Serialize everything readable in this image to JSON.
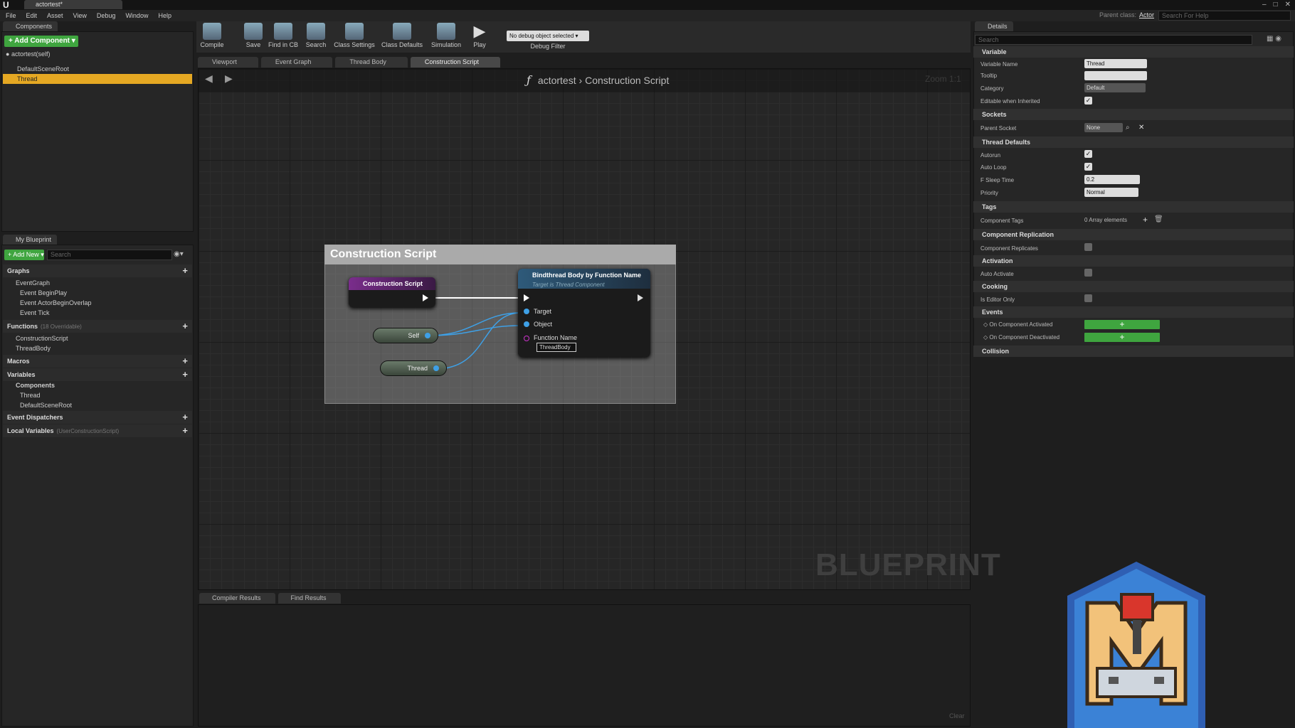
{
  "window": {
    "logo": "U",
    "doc_tab": "actortest*"
  },
  "menu": [
    "File",
    "Edit",
    "Asset",
    "View",
    "Debug",
    "Window",
    "Help"
  ],
  "parent_class": {
    "label": "Parent class:",
    "value": "Actor"
  },
  "help_search": {
    "placeholder": "Search For Help"
  },
  "components_panel": {
    "tab": "Components",
    "add_button": "+ Add Component ▾",
    "self_label": "actortest(self)",
    "items": [
      "DefaultSceneRoot",
      "Thread"
    ],
    "selected": "Thread"
  },
  "toolbar": {
    "buttons": [
      "Compile",
      "Save",
      "Find in CB",
      "Search",
      "Class Settings",
      "Class Defaults",
      "Simulation",
      "Play"
    ],
    "debug_select": "No debug object selected ▾",
    "debug_label": "Debug Filter"
  },
  "graph_tabs": [
    "Viewport",
    "Event Graph",
    "Thread Body",
    "Construction Script"
  ],
  "graph": {
    "breadcrumb_root": "actortest",
    "breadcrumb_sep": "›",
    "breadcrumb_current": "Construction Script",
    "zoom": "Zoom 1:1",
    "watermark": "BLUEPRINT",
    "comment_title": "Construction Script",
    "nodes": {
      "construction": "Construction Script",
      "self": "Self",
      "thread": "Thread",
      "bind_title": "Bindthread Body by Function Name",
      "bind_subtitle": "Target is Thread Component",
      "pin_target": "Target",
      "pin_object": "Object",
      "pin_function": "Function Name",
      "function_value": "ThreadBody"
    }
  },
  "my_blueprint": {
    "tab": "My Blueprint",
    "add_new": "+ Add New ▾",
    "search_placeholder": "Search",
    "graphs": "Graphs",
    "event_graph": "EventGraph",
    "events": [
      "Event BeginPlay",
      "Event ActorBeginOverlap",
      "Event Tick"
    ],
    "functions": "Functions",
    "functions_sub": "(18 Overridable)",
    "function_items": [
      "ConstructionScript",
      "ThreadBody"
    ],
    "macros": "Macros",
    "variables": "Variables",
    "components": "Components",
    "component_items": [
      "Thread",
      "DefaultSceneRoot"
    ],
    "dispatchers": "Event Dispatchers",
    "local_vars": "Local Variables",
    "local_vars_sub": "(UserConstructionScript)"
  },
  "bottom_tabs": [
    "Compiler Results",
    "Find Results"
  ],
  "clear": "Clear",
  "details": {
    "tab": "Details",
    "search_placeholder": "Search",
    "sections": {
      "variable": "Variable",
      "sockets": "Sockets",
      "thread_defaults": "Thread Defaults",
      "tags": "Tags",
      "replication": "Component Replication",
      "activation": "Activation",
      "cooking": "Cooking",
      "events": "Events",
      "collision": "Collision"
    },
    "labels": {
      "variable_name": "Variable Name",
      "tooltip": "Tooltip",
      "category": "Category",
      "editable": "Editable when Inherited",
      "parent_socket": "Parent Socket",
      "autorun": "Autorun",
      "auto_loop": "Auto Loop",
      "sleep_time": "F Sleep Time",
      "priority": "Priority",
      "component_tags": "Component Tags",
      "replicates": "Component Replicates",
      "auto_activate": "Auto Activate",
      "editor_only": "Is Editor Only",
      "on_activated": "On Component Activated",
      "on_deactivated": "On Component Deactivated"
    },
    "values": {
      "variable_name": "Thread",
      "tooltip": "",
      "category": "Default",
      "parent_socket": "None",
      "sleep_time": "0.2",
      "priority": "Normal",
      "component_tags": "0 Array elements"
    }
  },
  "colors": {
    "accent_green": "#3fa53f",
    "selection": "#e5a823",
    "construction_header": "#7a2d8c",
    "function_header": "#2e5a7a"
  }
}
